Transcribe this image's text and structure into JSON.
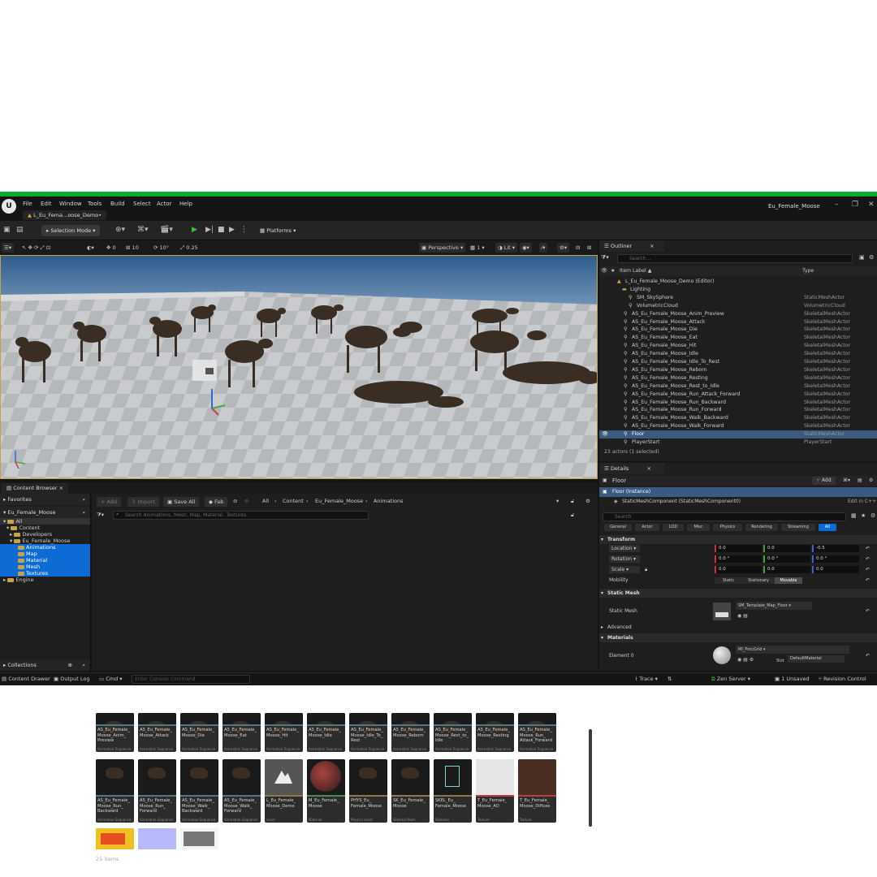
{
  "menu": [
    "File",
    "Edit",
    "Window",
    "Tools",
    "Build",
    "Select",
    "Actor",
    "Help"
  ],
  "level_tab": "L_Eu_Fema...oose_Demo•",
  "window_title": "Eu_Female_Moose",
  "toolbar": {
    "selection_mode": "Selection Mode",
    "platforms": "Platforms"
  },
  "viewport_bar": {
    "grid_values": [
      "0",
      "10",
      "10°",
      "0.25"
    ],
    "perspective": "Perspective",
    "lit": "Lit",
    "fov": "1"
  },
  "content_browser": {
    "tab": "Content Browser",
    "favorites": "Favorites",
    "project": "Eu_Female_Moose",
    "tree": [
      "All",
      "Content",
      "Developers",
      "Eu_Female_Moose",
      "Animations",
      "Map",
      "Material",
      "Mesh",
      "Textures",
      "Engine"
    ],
    "collections": "Collections",
    "add": "Add",
    "import": "Import",
    "save_all": "Save All",
    "fab": "Fab",
    "breadcrumb": [
      "All",
      "Content",
      "Eu_Female_Moose",
      "Animations"
    ],
    "search_placeholder": "Search Animations, Mesh, Map, Material, Textures",
    "item_count": "25 items",
    "row0": [
      {
        "name": "AS_Eu_Female_ Moose_Anim_ Preview",
        "kind": "Animation Sequence"
      },
      {
        "name": "AS_Eu_Female_ Moose_Attack",
        "kind": "Animation Sequence"
      },
      {
        "name": "AS_Eu_Female_ Moose_Die",
        "kind": "Animation Sequence"
      },
      {
        "name": "AS_Eu_Female_ Moose_Eat",
        "kind": "Animation Sequence"
      },
      {
        "name": "AS_Eu_Female_ Moose_Hit",
        "kind": "Animation Sequence"
      },
      {
        "name": "AS_Eu_Female_ Moose_Idle",
        "kind": "Animation Sequence"
      },
      {
        "name": "AS_Eu_Female_ Moose_Idle_To_ Rest",
        "kind": "Animation Sequence"
      },
      {
        "name": "AS_Eu_Female_ Moose_Reborn",
        "kind": "Animation Sequence"
      },
      {
        "name": "AS_Eu_Female_ Moose_Rest_to_ Idle",
        "kind": "Animation Sequence"
      },
      {
        "name": "AS_Eu_Female_ Moose_Resting",
        "kind": "Animation Sequence"
      },
      {
        "name": "AS_Eu_Female_ Moose_Run_ Attack_Forward",
        "kind": "Animation Sequence"
      }
    ],
    "row1": [
      {
        "name": "AS_Eu_Female_ Moose_Run_ Backward",
        "kind": "Animation Sequence"
      },
      {
        "name": "AS_Eu_Female_ Moose_Run_ Forward",
        "kind": "Animation Sequence"
      },
      {
        "name": "AS_Eu_Female_ Moose_Walk_ Backward",
        "kind": "Animation Sequence"
      },
      {
        "name": "AS_Eu_Female_ Moose_Walk_ Forward",
        "kind": "Animation Sequence"
      },
      {
        "name": "L_Eu_Female_ Moose_Demo",
        "kind": "Level"
      },
      {
        "name": "M_Eu_Female_ Moose",
        "kind": "Material"
      },
      {
        "name": "PHYS_Eu_ Female_Moose",
        "kind": "Physics Asset"
      },
      {
        "name": "SK_Eu_Female_ Moose",
        "kind": "Skeletal Mesh"
      },
      {
        "name": "SKEL_Eu_ Female_Moose",
        "kind": "Skeleton"
      },
      {
        "name": "T_Eu_Female_ Moose_AO",
        "kind": "Texture"
      },
      {
        "name": "T_Eu_Female_ Moose_Diffuse",
        "kind": "Texture"
      }
    ]
  },
  "outliner": {
    "tab": "Outliner",
    "search_placeholder": "Search...",
    "col_label": "Item Label ▲",
    "col_type": "Type",
    "rows": [
      {
        "label": "L_Eu_Female_Moose_Demo (Editor)",
        "type": ""
      },
      {
        "label": "Lighting",
        "type": ""
      },
      {
        "label": "SM_SkySphere",
        "type": "StaticMeshActor"
      },
      {
        "label": "VolumetricCloud",
        "type": "VolumetricCloud"
      },
      {
        "label": "AS_Eu_Female_Moose_Anim_Preview",
        "type": "SkeletalMeshActor"
      },
      {
        "label": "AS_Eu_Female_Moose_Attack",
        "type": "SkeletalMeshActor"
      },
      {
        "label": "AS_Eu_Female_Moose_Die",
        "type": "SkeletalMeshActor"
      },
      {
        "label": "AS_Eu_Female_Moose_Eat",
        "type": "SkeletalMeshActor"
      },
      {
        "label": "AS_Eu_Female_Moose_Hit",
        "type": "SkeletalMeshActor"
      },
      {
        "label": "AS_Eu_Female_Moose_Idle",
        "type": "SkeletalMeshActor"
      },
      {
        "label": "AS_Eu_Female_Moose_Idle_To_Rest",
        "type": "SkeletalMeshActor"
      },
      {
        "label": "AS_Eu_Female_Moose_Reborn",
        "type": "SkeletalMeshActor"
      },
      {
        "label": "AS_Eu_Female_Moose_Resting",
        "type": "SkeletalMeshActor"
      },
      {
        "label": "AS_Eu_Female_Moose_Rest_to_Idle",
        "type": "SkeletalMeshActor"
      },
      {
        "label": "AS_Eu_Female_Moose_Run_Attack_Forward",
        "type": "SkeletalMeshActor"
      },
      {
        "label": "AS_Eu_Female_Moose_Run_Backward",
        "type": "SkeletalMeshActor"
      },
      {
        "label": "AS_Eu_Female_Moose_Run_Forward",
        "type": "SkeletalMeshActor"
      },
      {
        "label": "AS_Eu_Female_Moose_Walk_Backward",
        "type": "SkeletalMeshActor"
      },
      {
        "label": "AS_Eu_Female_Moose_Walk_Forward",
        "type": "SkeletalMeshActor"
      },
      {
        "label": "Floor",
        "type": "StaticMeshActor"
      },
      {
        "label": "PlayerStart",
        "type": "PlayerStart"
      }
    ],
    "status": "23 actors (1 selected)"
  },
  "details": {
    "tab": "Details",
    "actor_name": "Floor",
    "add": "Add",
    "instance": "Floor (Instance)",
    "component": "StaticMeshComponent (StaticMeshComponent0)",
    "edit_cpp": "Edit in C++",
    "search_placeholder": "Search",
    "filters": [
      "General",
      "Actor",
      "LOD",
      "Misc",
      "Physics",
      "Rendering",
      "Streaming",
      "All"
    ],
    "transform": "Transform",
    "location": {
      "label": "Location",
      "x": "0.0",
      "y": "0.0",
      "z": "-0.5"
    },
    "rotation": {
      "label": "Rotation",
      "x": "0.0 °",
      "y": "0.0 °",
      "z": "0.0 °"
    },
    "scale": {
      "label": "Scale",
      "x": "0.0",
      "y": "0.0",
      "z": "0.0"
    },
    "mobility": {
      "label": "Mobility",
      "options": [
        "Static",
        "Stationary",
        "Movable"
      ],
      "selected": "Movable"
    },
    "static_mesh_section": "Static Mesh",
    "static_mesh_label": "Static Mesh",
    "static_mesh_value": "SM_Template_Map_Floor",
    "advanced": "Advanced",
    "materials": "Materials",
    "element0": "Element 0",
    "material_value": "MI_ProcGrid",
    "slot_label": "Slot",
    "slot_value": "DefaultMaterial"
  },
  "statusbar": {
    "content_drawer": "Content Drawer",
    "output_log": "Output Log",
    "cmd": "Cmd",
    "console_placeholder": "Enter Console Command",
    "trace": "Trace",
    "zen": "Zen Server",
    "unsaved": "1 Unsaved",
    "revision": "Revision Control"
  },
  "colors": {
    "accent": "#0d6bd6",
    "frame": "#0aa82e",
    "play": "#3bc43b",
    "folder": "#c8a24a"
  }
}
